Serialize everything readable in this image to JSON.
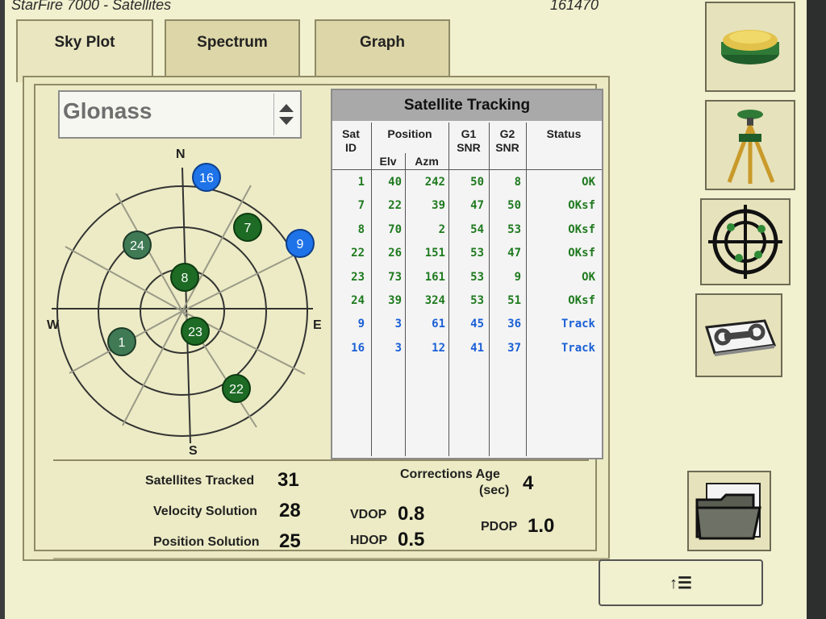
{
  "window": {
    "title": "StarFire 7000 - Satellites",
    "serial": "161470"
  },
  "tabs": [
    {
      "label": "Sky Plot"
    },
    {
      "label": "Spectrum"
    },
    {
      "label": "Graph"
    }
  ],
  "constellation_select": {
    "value": "Glonass"
  },
  "skyplot": {
    "compass": {
      "n": "N",
      "s": "S",
      "e": "E",
      "w": "W"
    },
    "satellites": [
      {
        "id": "16",
        "elv": 3,
        "azm": 12,
        "status": "Track"
      },
      {
        "id": "7",
        "elv": 22,
        "azm": 39,
        "status": "OKsf"
      },
      {
        "id": "9",
        "elv": 3,
        "azm": 61,
        "status": "Track"
      },
      {
        "id": "24",
        "elv": 39,
        "azm": 324,
        "status": "OKsf"
      },
      {
        "id": "8",
        "elv": 70,
        "azm": 2,
        "status": "OKsf"
      },
      {
        "id": "23",
        "elv": 73,
        "azm": 161,
        "status": "OK"
      },
      {
        "id": "1",
        "elv": 40,
        "azm": 242,
        "status": "OK"
      },
      {
        "id": "22",
        "elv": 26,
        "azm": 151,
        "status": "OKsf"
      }
    ]
  },
  "tracking": {
    "title": "Satellite Tracking",
    "headers": {
      "sat": "Sat",
      "id": "ID",
      "position": "Position",
      "elv": "Elv",
      "azm": "Azm",
      "g1": "G1",
      "g1b": "SNR",
      "g2": "G2",
      "g2b": "SNR",
      "status": "Status"
    },
    "rows": [
      {
        "id": "1",
        "elv": "40",
        "azm": "242",
        "g1": "50",
        "g2": "8",
        "status": "OK",
        "kind": "ok"
      },
      {
        "id": "7",
        "elv": "22",
        "azm": "39",
        "g1": "47",
        "g2": "50",
        "status": "OKsf",
        "kind": "ok"
      },
      {
        "id": "8",
        "elv": "70",
        "azm": "2",
        "g1": "54",
        "g2": "53",
        "status": "OKsf",
        "kind": "ok"
      },
      {
        "id": "22",
        "elv": "26",
        "azm": "151",
        "g1": "53",
        "g2": "47",
        "status": "OKsf",
        "kind": "ok"
      },
      {
        "id": "23",
        "elv": "73",
        "azm": "161",
        "g1": "53",
        "g2": "9",
        "status": "OK",
        "kind": "ok"
      },
      {
        "id": "24",
        "elv": "39",
        "azm": "324",
        "g1": "53",
        "g2": "51",
        "status": "OKsf",
        "kind": "ok"
      },
      {
        "id": "9",
        "elv": "3",
        "azm": "61",
        "g1": "45",
        "g2": "36",
        "status": "Track",
        "kind": "track"
      },
      {
        "id": "16",
        "elv": "3",
        "azm": "12",
        "g1": "41",
        "g2": "37",
        "status": "Track",
        "kind": "track"
      }
    ]
  },
  "stats": {
    "satellites_tracked_label": "Satellites Tracked",
    "satellites_tracked": "31",
    "velocity_solution_label": "Velocity Solution",
    "velocity_solution": "28",
    "position_solution_label": "Position Solution",
    "position_solution": "25",
    "corrections_age_label_1": "Corrections Age",
    "corrections_age_label_2": "(sec)",
    "corrections_age": "4",
    "vdop_label": "VDOP",
    "vdop": "0.8",
    "hdop_label": "HDOP",
    "hdop": "0.5",
    "pdop_label": "PDOP",
    "pdop": "1.0"
  },
  "footer": {
    "button_label": "↑☰"
  },
  "colors": {
    "ok": "#1f7a1f",
    "track": "#1a5fd6",
    "sat_green": "#1d6b24",
    "sat_blue": "#1e73e8"
  },
  "icons": [
    "receiver-icon",
    "tripod-icon",
    "satellite-target-icon",
    "manual-wrench-icon",
    "folder-icon"
  ]
}
